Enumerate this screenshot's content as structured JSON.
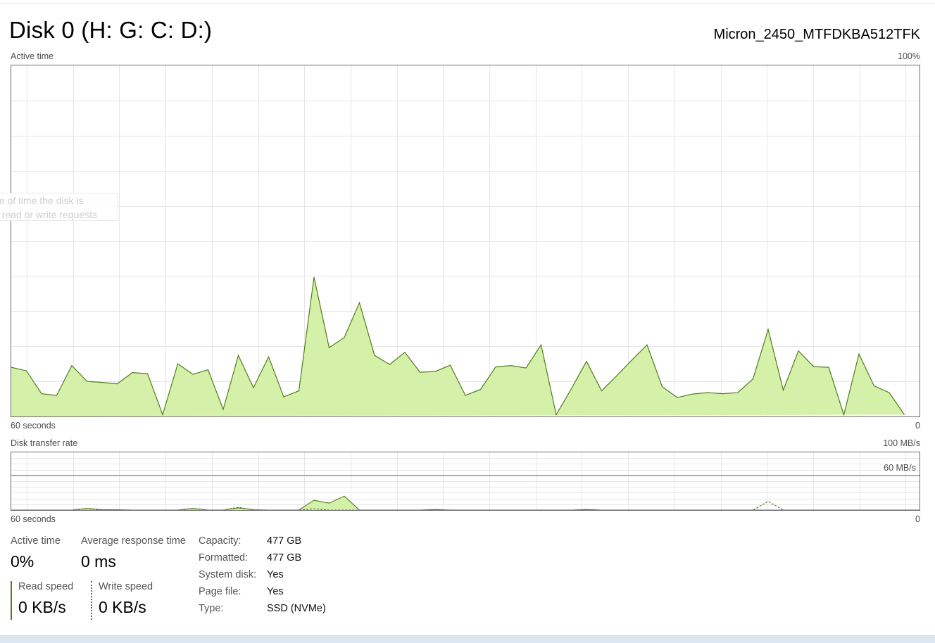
{
  "header": {
    "title": "Disk 0 (H: G: C: D:)",
    "model": "Micron_2450_MTFDKBA512TFK"
  },
  "active_chart": {
    "label": "Active time",
    "max_label": "100%",
    "x_left_label": "60 seconds",
    "x_right_label": "0",
    "tooltip_line1": "ge of time the disk is",
    "tooltip_line2": "g read or write requests"
  },
  "transfer_chart": {
    "label": "Disk transfer rate",
    "max_label": "100 MB/s",
    "ref_label": "60 MB/s",
    "x_left_label": "60 seconds",
    "x_right_label": "0"
  },
  "stats": {
    "active_time_label": "Active time",
    "active_time_value": "0%",
    "avg_response_label": "Average response time",
    "avg_response_value": "0 ms",
    "read_label": "Read speed",
    "read_value": "0 KB/s",
    "write_label": "Write speed",
    "write_value": "0 KB/s"
  },
  "properties": [
    {
      "label": "Capacity:",
      "value": "477 GB"
    },
    {
      "label": "Formatted:",
      "value": "477 GB"
    },
    {
      "label": "System disk:",
      "value": "Yes"
    },
    {
      "label": "Page file:",
      "value": "Yes"
    },
    {
      "label": "Type:",
      "value": "SSD (NVMe)"
    }
  ],
  "colors": {
    "fill": "#d5f0a8",
    "line": "#4f7f1a",
    "grid": "#e6e6e6",
    "border": "#6a6a6a"
  },
  "chart_data": [
    {
      "type": "area",
      "title": "Active time",
      "xlabel": "60 seconds",
      "ylabel": "",
      "ylim": [
        0,
        100
      ],
      "x": [
        60,
        59,
        58,
        57,
        56,
        55,
        54,
        53,
        52,
        51,
        50,
        49,
        48,
        47,
        46,
        45,
        44,
        43,
        42,
        41,
        40,
        39,
        38,
        37,
        36,
        35,
        34,
        33,
        32,
        31,
        30,
        29,
        28,
        27,
        26,
        25,
        24,
        23,
        22,
        21,
        20,
        19,
        18,
        17,
        16,
        15,
        14,
        13,
        12,
        11,
        10,
        9,
        8,
        7,
        6,
        5,
        4,
        3,
        2,
        1,
        0
      ],
      "series": [
        {
          "values": [
            14,
            13,
            6.5,
            6,
            14.5,
            10,
            9.7,
            9.3,
            12.5,
            12.2,
            0.5,
            15,
            12,
            13.3,
            2,
            17.4,
            8.2,
            17,
            5.6,
            7.3,
            39.7,
            19.6,
            22.5,
            32.4,
            17.4,
            14.8,
            18.3,
            12.6,
            12.8,
            14.6,
            6,
            7.7,
            14.1,
            14.5,
            13.8,
            20.4,
            0.5,
            7.9,
            15.7,
            7.3,
            11.6,
            16.1,
            20.4,
            8.5,
            5.4,
            6.4,
            6.8,
            6.5,
            6.8,
            10.7,
            24.8,
            7.5,
            18.7,
            14.2,
            14,
            0.5,
            17.8,
            8.7,
            6.8,
            0.5
          ]
        }
      ]
    },
    {
      "type": "area",
      "title": "Disk transfer rate",
      "xlabel": "60 seconds",
      "ylabel": "",
      "ylim": [
        0,
        100
      ],
      "x": [
        60,
        59,
        58,
        57,
        56,
        55,
        54,
        53,
        52,
        51,
        50,
        49,
        48,
        47,
        46,
        45,
        44,
        43,
        42,
        41,
        40,
        39,
        38,
        37,
        36,
        35,
        34,
        33,
        32,
        31,
        30,
        29,
        28,
        27,
        26,
        25,
        24,
        23,
        22,
        21,
        20,
        19,
        18,
        17,
        16,
        15,
        14,
        13,
        12,
        11,
        10,
        9,
        8,
        7,
        6,
        5,
        4,
        3,
        2,
        1,
        0
      ],
      "series": [
        {
          "values": [
            0,
            0,
            0,
            0,
            0,
            3,
            0.5,
            0.5,
            0,
            0,
            0,
            0,
            3,
            0,
            0,
            3.5,
            0.5,
            0,
            0,
            0,
            17,
            12,
            24,
            0,
            0,
            0,
            0,
            0,
            1,
            0,
            0,
            0,
            0,
            0,
            0,
            0,
            0,
            0,
            1,
            0,
            0,
            0,
            0,
            0,
            0,
            0,
            0,
            0,
            0,
            0,
            0,
            0,
            0,
            0,
            0,
            0,
            0,
            0,
            0,
            0,
            0
          ]
        },
        {
          "values": [
            0,
            0,
            0,
            0,
            0,
            0,
            0,
            0,
            0,
            0,
            0,
            0,
            0,
            0,
            0,
            5,
            0,
            0,
            0,
            0,
            2,
            0,
            0,
            0,
            0,
            0,
            0,
            0,
            0,
            0,
            0,
            0,
            0,
            0,
            0,
            0,
            0,
            0,
            0,
            0,
            0,
            0,
            0,
            0,
            0,
            0,
            0,
            0,
            0,
            0,
            15,
            0,
            0,
            0,
            0,
            0,
            0,
            0,
            0,
            0,
            0
          ]
        }
      ]
    }
  ]
}
